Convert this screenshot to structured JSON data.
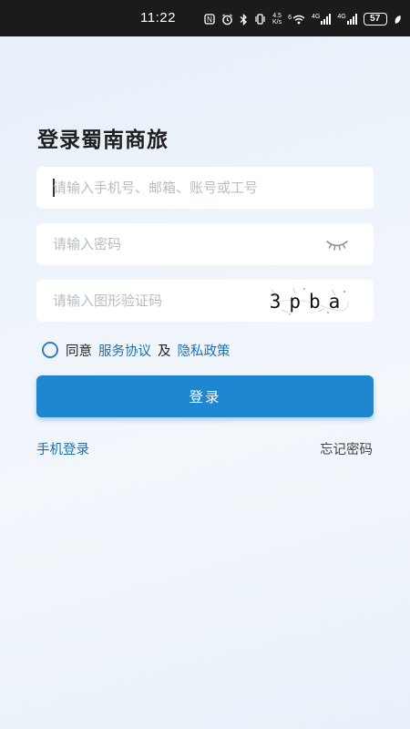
{
  "status_bar": {
    "time": "11:22",
    "nfc_icon": "N",
    "net_speed_value": "4.5",
    "net_speed_unit": "K/s",
    "wifi_label": "6",
    "net1_label": "4G",
    "net2_label": "4G",
    "battery": "57"
  },
  "page": {
    "title": "登录蜀南商旅"
  },
  "form": {
    "account_placeholder": "请输入手机号、邮箱、账号或工号",
    "password_placeholder": "请输入密码",
    "captcha_placeholder": "请输入图形验证码",
    "captcha_text": "3pba"
  },
  "agreement": {
    "prefix": "同意",
    "service_link": "服务协议",
    "conjunction": "及",
    "privacy_link": "隐私政策"
  },
  "actions": {
    "login_button": "登录",
    "phone_login": "手机登录",
    "forgot_password": "忘记密码"
  },
  "colors": {
    "accent": "#1e87d2",
    "link": "#1f6fb0",
    "status_bar_bg": "#1b1b1d"
  },
  "icons": {
    "password_toggle": "eye-closed-icon",
    "agreement_checkbox": "radio-unchecked-icon"
  }
}
